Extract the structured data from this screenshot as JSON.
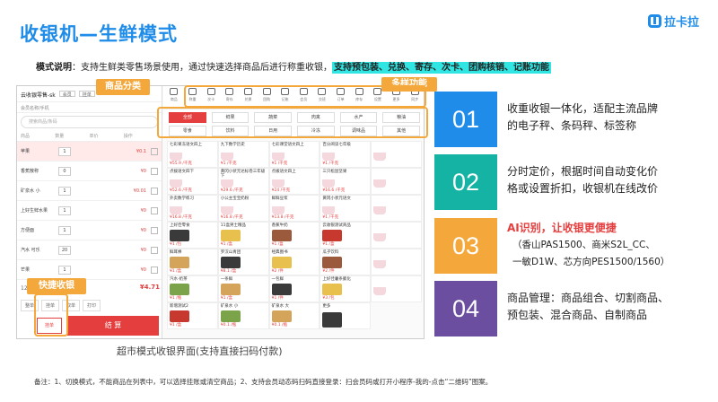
{
  "title": "收银机—生鲜模式",
  "logo": "拉卡拉",
  "mode_desc": {
    "label": "模式说明",
    "text": "：支持生鲜类零售场景使用，通过快速选择商品后进行称重收银，",
    "highlight": "支持预包装、兑换、寄存、次卡、团购核销、记账功能"
  },
  "tags": {
    "product_category": "商品分类",
    "features": "多样功能",
    "quick_checkout": "快捷收银"
  },
  "pos": {
    "store": "云收银零售-sk",
    "sub": "会员名称/手机",
    "head_btns": [
      "会员",
      "挂单"
    ],
    "search": "搜索商品/条码",
    "cols": [
      "商品",
      "数量",
      "单价",
      "操作"
    ],
    "cart": [
      {
        "name": "苹果",
        "qty": "1",
        "price": "¥0.1"
      },
      {
        "name": "香蕉散称",
        "qty": "0",
        "price": "¥0"
      },
      {
        "name": "矿泉水 小",
        "qty": "1",
        "price": "¥0.01"
      },
      {
        "name": "上好生鲜水果",
        "qty": "1",
        "price": "¥0"
      },
      {
        "name": "方便面",
        "qty": "1",
        "price": "¥0"
      },
      {
        "name": "汽水 可乐",
        "qty": "20",
        "price": "¥0"
      },
      {
        "name": "芒果",
        "qty": "1",
        "price": "¥0"
      }
    ],
    "total_label": "12 优惠",
    "total": "¥4.71",
    "btns": [
      "整单",
      "挂单",
      "取单",
      "打印"
    ],
    "hold": "挂单",
    "pay": "结 算",
    "icons": [
      "商品",
      "称重",
      "次卡",
      "寄存",
      "兑换",
      "团购",
      "记账",
      "会员",
      "交班",
      "订单",
      "库存",
      "设置",
      "更多",
      "同步"
    ],
    "categories": [
      "全部",
      "鲜果",
      "蔬菜",
      "肉禽",
      "水产",
      "粮油",
      "零食",
      "饮料",
      "日用",
      "冷冻",
      "调味品",
      "其他"
    ],
    "items": [
      {
        "name": "七彩果冻语文四上",
        "price": "¥55.9 /千克"
      },
      {
        "name": "九下数学历史",
        "price": "¥1 /千克"
      },
      {
        "name": "七彩课堂语文四上",
        "price": "¥1 /千克"
      },
      {
        "name": "百分阅读七年级",
        "price": "¥1 /千克"
      },
      {
        "name": "",
        "price": ""
      },
      {
        "name": "点拨语文四下",
        "price": "¥52.6 /千克"
      },
      {
        "name": "黄冈小状元达标卷三年级下",
        "price": "¥29.6 /千克"
      },
      {
        "name": "点拨语文四上",
        "price": "¥24 /千克"
      },
      {
        "name": "三只松鼠坚果",
        "price": "¥16.6 /千克"
      },
      {
        "name": "",
        "price": ""
      },
      {
        "name": "外卖数学练习",
        "price": "¥16.8 /千克"
      },
      {
        "name": "小公主宝宝奶粉",
        "price": "¥16.8 /千克"
      },
      {
        "name": "鲜鲜豆浆",
        "price": "¥13.8 /千克"
      },
      {
        "name": "黄冈小状元语文",
        "price": "¥1 /千克"
      },
      {
        "name": "",
        "price": ""
      },
      {
        "name": "上好佳零食",
        "price": "¥1 /包"
      },
      {
        "name": "11盒男士精品",
        "price": "¥1 /盒"
      },
      {
        "name": "香蕉牛奶",
        "price": "¥1 /盒"
      },
      {
        "name": "云收银测试商品",
        "price": "¥1 /盒"
      },
      {
        "name": "",
        "price": ""
      },
      {
        "name": "鲜耳棒",
        "price": "¥1 /盒"
      },
      {
        "name": "罗汉山青团",
        "price": "¥8.1 /盒"
      },
      {
        "name": "经典图书",
        "price": "¥2 /件"
      },
      {
        "name": "瓜子饮料",
        "price": "¥2 /件"
      },
      {
        "name": "",
        "price": ""
      },
      {
        "name": "汽水-奶茶",
        "price": "¥1 /瓶"
      },
      {
        "name": "一条鲜",
        "price": "¥1 /盒"
      },
      {
        "name": "一包鲜",
        "price": "¥1 /件"
      },
      {
        "name": "上好佳薯条膨化",
        "price": "¥3 /包"
      },
      {
        "name": "",
        "price": ""
      },
      {
        "name": "新增测试2",
        "price": "¥1 /盒"
      },
      {
        "name": "矿泉水 小",
        "price": "¥0.1 /瓶"
      },
      {
        "name": "矿泉水 大",
        "price": "¥0.1 /瓶"
      },
      {
        "name": "更多",
        "price": ""
      }
    ]
  },
  "features": [
    {
      "num": "01",
      "color": "#1e8ce8",
      "lines": [
        "收重收银一体化，适配主流品牌",
        "的电子秤、条码秤、标签称"
      ]
    },
    {
      "num": "02",
      "color": "#14b3a4",
      "lines": [
        "分时定价，根据时间自动变化价",
        "格或设置折扣，收银机在线改价"
      ]
    },
    {
      "num": "03",
      "color": "#f4a83b",
      "lines": [
        "AI识别，让收银更便捷",
        "（香山PAS1500、商米S2L_CC、",
        "一敏D1W、芯方向PES1500/1560）"
      ]
    },
    {
      "num": "04",
      "color": "#6b4ea0",
      "lines": [
        "商品管理：商品组合、切割商品、",
        "预包装、混合商品、自制商品"
      ]
    }
  ],
  "caption": "超市模式收银界面(支持直接扫码付款)",
  "note": "备注：1、切换模式，不能商品在列表中，可以选择挂账或清空商品；2、支持会员动态码扫码直接登录：扫会员码或打开小程序-我的-点击“二维码”图案。"
}
